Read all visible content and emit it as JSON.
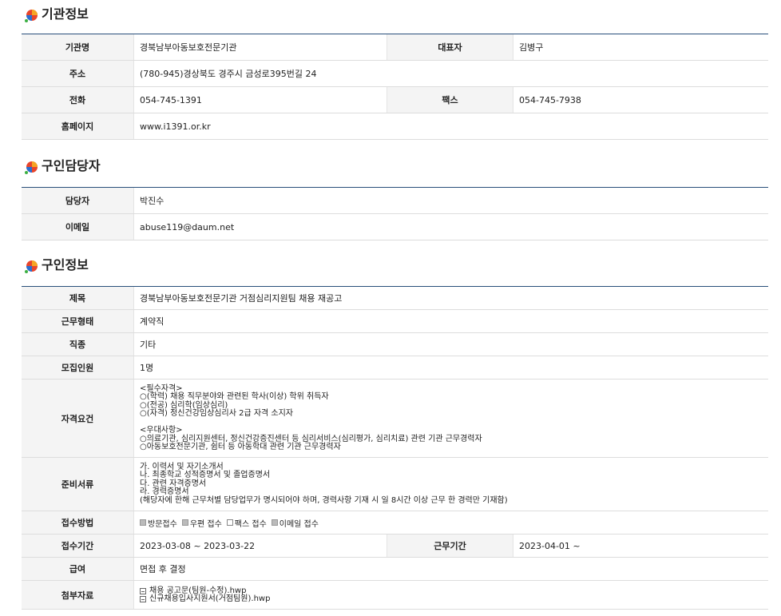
{
  "agency": {
    "title": "기관정보",
    "name_label": "기관명",
    "name": "경북남부아동보호전문기관",
    "rep_label": "대표자",
    "rep": "김병구",
    "address_label": "주소",
    "address": "(780-945)경상북도 경주시 금성로395번길 24",
    "phone_label": "전화",
    "phone": "054-745-1391",
    "fax_label": "팩스",
    "fax": "054-745-7938",
    "homepage_label": "홈페이지",
    "homepage": "www.i1391.or.kr"
  },
  "contact": {
    "title": "구인담당자",
    "person_label": "담당자",
    "person": "박진수",
    "email_label": "이메일",
    "email": "abuse119@daum.net"
  },
  "job": {
    "title": "구인정보",
    "subject_label": "제목",
    "subject": "경북남부아동보호전문기관 거점심리지원팀 채용 재공고",
    "worktype_label": "근무형태",
    "worktype": "계약직",
    "category_label": "직종",
    "category": "기타",
    "headcount_label": "모집인원",
    "headcount": "1명",
    "qual_label": "자격요건",
    "qual_lines": [
      "<필수자격>",
      "○(학력) 채용 직무분야와 관련된 학사(이상) 학위 취득자",
      "○(전공) 심리학(임상심리)",
      "○(자격) 정신건강임상심리사 2급 자격 소지자",
      "",
      "<우대사항>",
      "○의료기관, 심리지원센터, 정신건강증진센터 등 심리서비스(심리평가, 심리치료) 관련 기관 근무경력자",
      "○아동보호전문기관, 쉼터 등 아동학대 관련 기관 근무경력자"
    ],
    "docs_label": "준비서류",
    "docs_lines": [
      "가. 이력서 및 자기소개서",
      "나. 최종학교 성적증명서 및 졸업증명서",
      "다. 관련 자격증명서",
      "라. 경력증명서",
      "(해당자에 한해 근무처별 담당업무가 명시되어야 하며, 경력사항 기재 시  일 8시간 이상 근무 한 경력만 기재함)"
    ],
    "method_label": "접수방법",
    "methods": [
      "방문접수",
      "우편 접수",
      "팩스 접수",
      "이메일 접수"
    ],
    "period_label": "접수기간",
    "period": "2023-03-08 ~ 2023-03-22",
    "workperiod_label": "근무기간",
    "workperiod": "2023-04-01 ~",
    "salary_label": "급여",
    "salary": "면접 후 결정",
    "attach_label": "첨부자료",
    "attachments": [
      "채용 공고문(팀원-수정).hwp",
      "신규채용입사지원서(거점팀원).hwp"
    ]
  },
  "colors": {
    "top_border": "#284f7a",
    "header_bg": "#f4f4f4"
  }
}
